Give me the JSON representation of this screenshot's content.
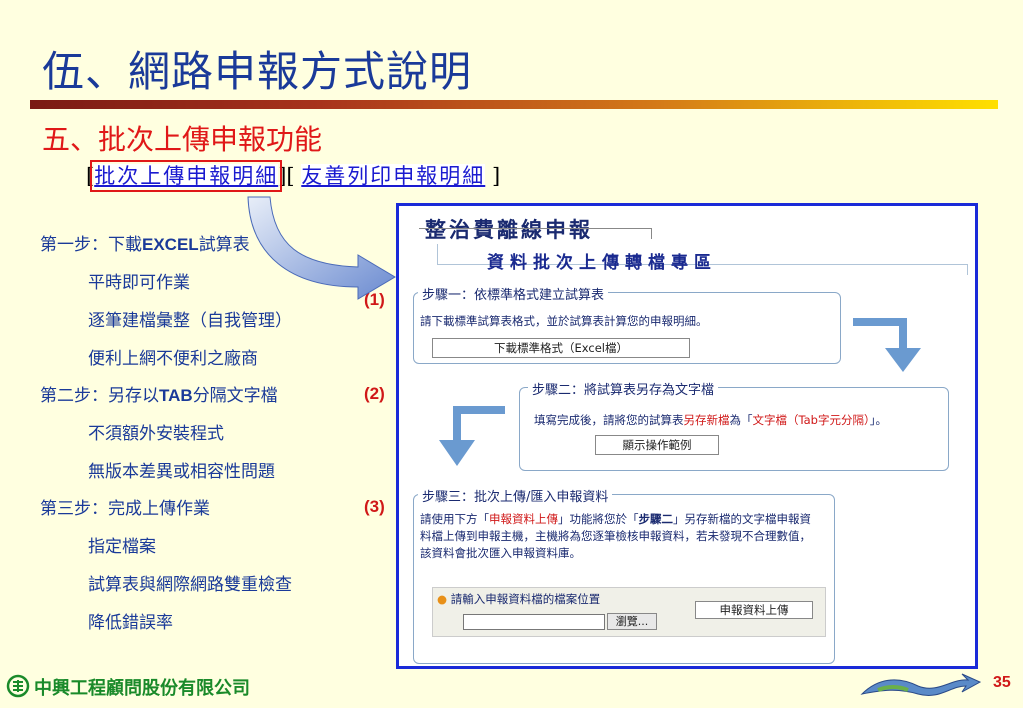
{
  "title": "伍、網路申報方式說明",
  "subtitle": "五、批次上傳申報功能",
  "links": {
    "open": "[",
    "link1": "批次上傳申報明細",
    "mid": "][ ",
    "link2": "友善列印申報明細",
    "close": " ]"
  },
  "steps": [
    {
      "prefix": "第一步：下載",
      "bold": "EXCEL",
      "suffix": "試算表",
      "items": [
        "平時即可作業",
        "逐筆建檔彙整（自我管理）",
        "便利上網不便利之廠商"
      ]
    },
    {
      "prefix": "第二步：另存以",
      "bold": "TAB",
      "suffix": "分隔文字檔",
      "items": [
        "不須額外安裝程式",
        "無版本差異或相容性問題"
      ]
    },
    {
      "prefix": "第三步：完成上傳作業",
      "bold": "",
      "suffix": "",
      "items": [
        "指定檔案",
        "試算表與網際網路雙重檢查",
        "降低錯誤率"
      ]
    }
  ],
  "step_numbers": [
    "(1)",
    "(2)",
    "(3)"
  ],
  "panel": {
    "title": "整治費離線申報",
    "subtitle": "資料批次上傳轉檔專區",
    "box1": {
      "title_label": "步驟一",
      "title_text": "：依標準格式建立試算表",
      "text": "請下載標準試算表格式，並於試算表計算您的申報明細。",
      "button": "下載標準格式（Excel檔）"
    },
    "box2": {
      "title_label": "步驟二",
      "title_text": "：將試算表另存為文字檔",
      "text_a": "填寫完成後，請將您的試算表",
      "text_b": "另存新檔",
      "text_c": "為「",
      "text_d": "文字檔（Tab字元分隔）",
      "text_e": "」。",
      "button": "顯示操作範例"
    },
    "box3": {
      "title_label": "步驟三",
      "title_text": "：批次上傳/匯入申報資料",
      "text_a": "請使用下方「",
      "text_b": "申報資料上傳",
      "text_c": "」功能將您於「",
      "text_d": "步驟二",
      "text_e": "」另存新檔的文字檔申報資料檔上傳到申報主機，主機將為您逐筆檢核申報資料，若未發現不合理數值，該資料會批次匯入申報資料庫。",
      "file_label": "請輸入申報資料檔的檔案位置",
      "file_value": "",
      "browse_button": "瀏覽...",
      "upload_button": "申報資料上傳"
    }
  },
  "footer": {
    "company": "中興工程顧問股份有限公司",
    "page_number": "35"
  },
  "colors": {
    "background": "#ffffe0",
    "title": "#1a3a99",
    "subtitle": "#e01818",
    "panel_border": "#1a2ad8",
    "arrow": "#6a9ad0",
    "company": "#1a8a2a"
  }
}
